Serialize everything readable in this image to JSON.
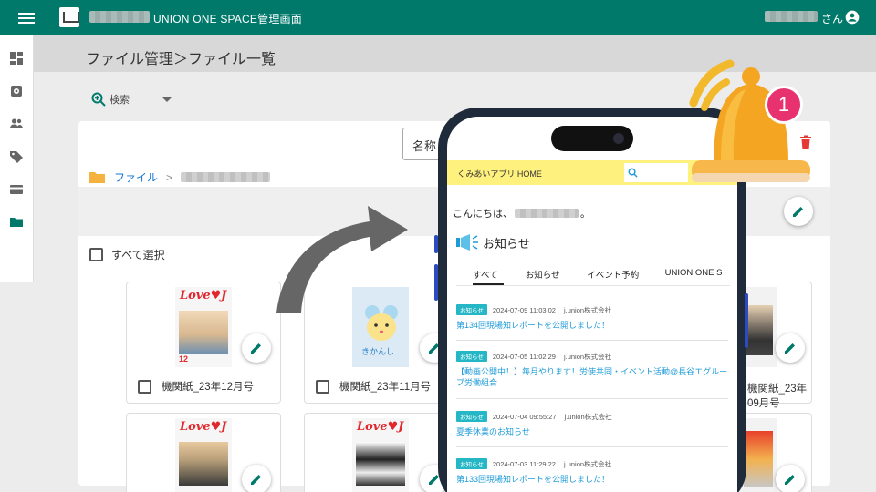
{
  "topbar": {
    "title": "UNION ONE SPACE管理画面",
    "user_suffix": "さん"
  },
  "sidebar": {
    "items": [
      {
        "icon": "dashboard-icon"
      },
      {
        "icon": "settings-icon"
      },
      {
        "icon": "people-icon"
      },
      {
        "icon": "tag-icon"
      },
      {
        "icon": "card-icon"
      },
      {
        "icon": "folder-icon"
      }
    ]
  },
  "header": {
    "title": "ファイル管理＞ファイル一覧"
  },
  "search": {
    "label": "検索"
  },
  "filter": {
    "name_field": "名称"
  },
  "breadcrumb": {
    "root": "ファイル",
    "separator": ">"
  },
  "list": {
    "select_all": "すべて選択",
    "cards": [
      {
        "label": "機関紙_23年12月号",
        "thumb": "Love J magazine"
      },
      {
        "label": "機関紙_23年11月号",
        "thumb": "きかんし"
      },
      {
        "label": "機関紙_23年09月号",
        "thumb": "magazine"
      },
      {
        "label": "",
        "thumb": "Love J magazine"
      },
      {
        "label": "",
        "thumb": "Love J magazine"
      },
      {
        "label": "",
        "thumb": "magazine"
      }
    ],
    "mag_brand": "Love♥J",
    "mag_number": "12",
    "mascot_text": "きかんし"
  },
  "phone": {
    "app_title": "くみあいアプリ HOME",
    "greeting_prefix": "こんにちは、",
    "greeting_suffix": "。",
    "news_heading": "お知らせ",
    "tabs": [
      "すべて",
      "お知らせ",
      "イベント予約",
      "UNION ONE S"
    ],
    "news": [
      {
        "badge": "お知らせ",
        "date": "2024-07-09 11:03:02",
        "source": "j.union株式会社",
        "title": "第134回現場知レポートを公開しました！"
      },
      {
        "badge": "お知らせ",
        "date": "2024-07-05 11:02:29",
        "source": "j.union株式会社",
        "title": "【動画公開中！】毎月やります！労使共同・イベント活動@長谷エグループ労働組合"
      },
      {
        "badge": "お知らせ",
        "date": "2024-07-04 09:55:27",
        "source": "j.union株式会社",
        "title": "夏季休業のお知らせ"
      },
      {
        "badge": "お知らせ",
        "date": "2024-07-03 11:29:22",
        "source": "j.union株式会社",
        "title": "第133回現場知レポートを公開しました！"
      }
    ]
  },
  "notification": {
    "count": "1"
  },
  "colors": {
    "topbar": "#00796b",
    "link": "#1976d2",
    "delete": "#e53935",
    "badge": "#e8326f",
    "app_bar": "#fff17e",
    "news_badge": "#26b7c6"
  }
}
